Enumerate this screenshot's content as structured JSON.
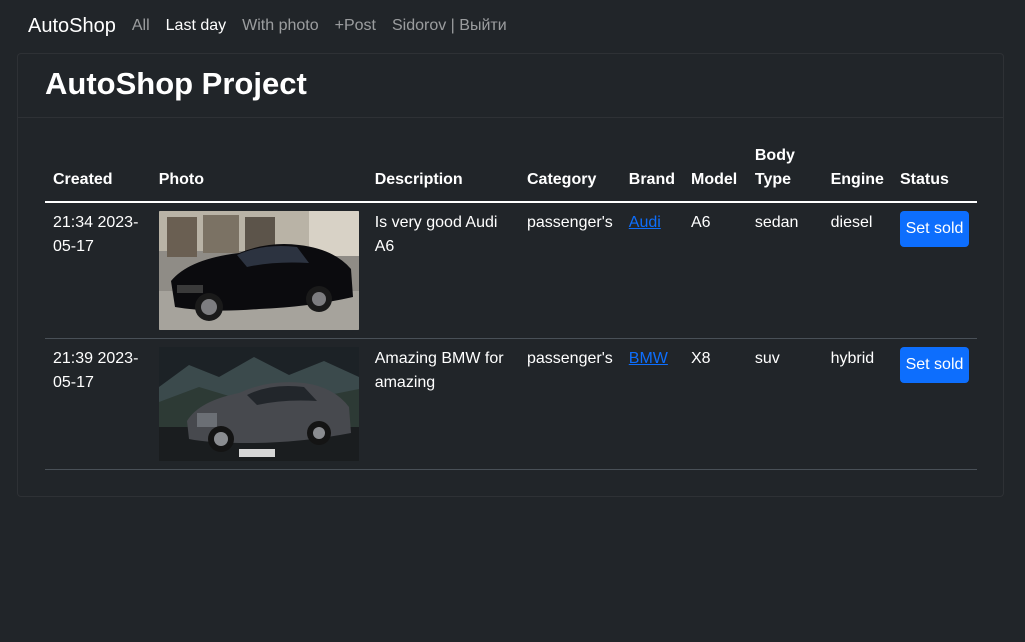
{
  "nav": {
    "brand": "AutoShop",
    "links": [
      {
        "label": "All",
        "active": false
      },
      {
        "label": "Last day",
        "active": true
      },
      {
        "label": "With photo",
        "active": false
      },
      {
        "label": "+Post",
        "active": false
      },
      {
        "label": "Sidorov | Выйти",
        "active": false
      }
    ]
  },
  "page": {
    "title": "AutoShop Project"
  },
  "table": {
    "headers": {
      "created": "Created",
      "photo": "Photo",
      "description": "Description",
      "category": "Category",
      "brand": "Brand",
      "model": "Model",
      "body_type": "Body Type",
      "engine": "Engine",
      "status": "Status"
    },
    "rows": [
      {
        "created": "21:34 2023-05-17",
        "photo_subject": "black Audi A6 sedan",
        "description": "Is very good Audi A6",
        "category": "passenger's",
        "brand": "Audi",
        "model": "A6",
        "body_type": "sedan",
        "engine": "diesel",
        "status_button": "Set sold"
      },
      {
        "created": "21:39 2023-05-17",
        "photo_subject": "grey BMW X8 SUV",
        "description": "Amazing BMW for amazing",
        "category": "passenger's",
        "brand": "BMW",
        "model": "X8",
        "body_type": "suv",
        "engine": "hybrid",
        "status_button": "Set sold"
      }
    ]
  },
  "colors": {
    "background": "#212529",
    "accent": "#0d6efd",
    "link": "#0d6efd"
  }
}
